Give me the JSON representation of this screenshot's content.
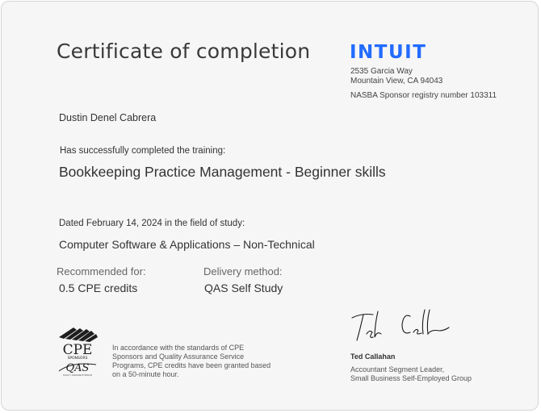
{
  "certificate": {
    "title": "Certificate of completion",
    "issuer": {
      "logo_text": "INTUIT",
      "address_line1": "2535 Garcia Way",
      "address_line2": "Mountain View, CA 94043",
      "registry": "NASBA Sponsor registry number 103311"
    },
    "recipient_name": "Dustin Denel Cabrera",
    "completed_label": "Has successfully completed the training:",
    "course_title": "Bookkeeping Practice Management - Beginner skills",
    "dated_text": "Dated February 14, 2024 in the field of study:",
    "field_of_study": "Computer Software & Applications – Non-Technical",
    "recommended_label": "Recommended for:",
    "recommended_value": "0.5 CPE credits",
    "delivery_label": "Delivery method:",
    "delivery_value": "QAS Self Study",
    "cpe_logo": {
      "top_text": "CPE",
      "sponsors_text": "SPONSORS",
      "qas_text": "QAS",
      "tiny_text": "QUALITY ASSURANCE SERVICE"
    },
    "standards_text": "In accordance with the standards of CPE Sponsors and Quality Assurance Service Programs, CPE credits have been granted based on a 50-minute hour.",
    "signer_name": "Ted Callahan",
    "signer_role_line1": "Accountant Segment Leader,",
    "signer_role_line2": "Small Business Self-Employed Group",
    "colors": {
      "brand": "#236cff",
      "background": "#f6f6f6"
    }
  }
}
